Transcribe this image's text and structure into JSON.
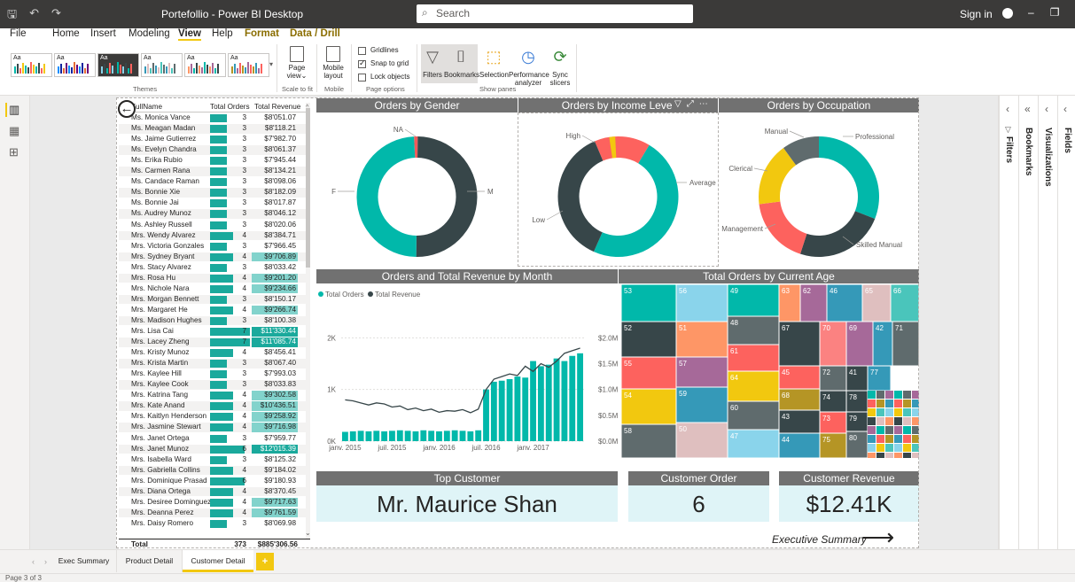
{
  "window": {
    "title": "Portefollio - Power BI Desktop",
    "search_placeholder": "Search",
    "signin": "Sign in",
    "min": "–",
    "max": "❐",
    "close": "✕",
    "save_icon": "🖫",
    "undo": "↶",
    "redo": "↷"
  },
  "menu": [
    "File",
    "Home",
    "Insert",
    "Modeling",
    "View",
    "Help",
    "Format",
    "Data / Drill"
  ],
  "ribbon": {
    "themes_label": "Themes",
    "scale_label": "Scale to fit",
    "page_view": "Page view",
    "page_view_dd": "⌄",
    "mobile_group": "Mobile",
    "mobile_layout": "Mobile layout",
    "page_options_label": "Page options",
    "gridlines": "Gridlines",
    "snap": "Snap to grid",
    "lock": "Lock objects",
    "show_panes_label": "Show panes",
    "panes": [
      "Filters",
      "Bookmarks",
      "Selection",
      "Performance analyzer",
      "Sync slicers"
    ],
    "theme_colors": [
      "#118dff",
      "#12239e",
      "#e66c37",
      "#6b007b",
      "#e044a7",
      "#744ec2",
      "#d9b300",
      "#d64550"
    ]
  },
  "panes": {
    "filters": "Filters",
    "visualizations": "Visualizations",
    "fields": "Fields",
    "bookmarks": "Bookmarks"
  },
  "table": {
    "headers": [
      "FullName",
      "Total Orders",
      "Total Revenue"
    ],
    "rows": [
      [
        "Ms. Monica Vance",
        "3",
        "$8'051.07"
      ],
      [
        "Ms. Meagan Madan",
        "3",
        "$8'118.21"
      ],
      [
        "Ms. Jaime Gutierrez",
        "3",
        "$7'982.70"
      ],
      [
        "Ms. Evelyn Chandra",
        "3",
        "$8'061.37"
      ],
      [
        "Ms. Erika Rubio",
        "3",
        "$7'945.44"
      ],
      [
        "Ms. Carmen Rana",
        "3",
        "$8'134.21"
      ],
      [
        "Ms. Candace Raman",
        "3",
        "$8'098.06"
      ],
      [
        "Ms. Bonnie Xie",
        "3",
        "$8'182.09"
      ],
      [
        "Ms. Bonnie Jai",
        "3",
        "$8'017.87"
      ],
      [
        "Ms. Audrey Munoz",
        "3",
        "$8'046.12"
      ],
      [
        "Ms. Ashley Russell",
        "3",
        "$8'020.06"
      ],
      [
        "Mrs. Wendy Alvarez",
        "4",
        "$8'384.71"
      ],
      [
        "Mrs. Victoria Gonzales",
        "3",
        "$7'966.45"
      ],
      [
        "Mrs. Sydney Bryant",
        "4",
        "$9'706.89"
      ],
      [
        "Mrs. Stacy Alvarez",
        "3",
        "$8'033.42"
      ],
      [
        "Mrs. Rosa Hu",
        "4",
        "$9'201.20"
      ],
      [
        "Mrs. Nichole Nara",
        "4",
        "$9'234.66"
      ],
      [
        "Mrs. Morgan Bennett",
        "3",
        "$8'150.17"
      ],
      [
        "Mrs. Margaret He",
        "4",
        "$9'266.74"
      ],
      [
        "Mrs. Madison Hughes",
        "3",
        "$8'100.38"
      ],
      [
        "Mrs. Lisa Cai",
        "7",
        "$11'330.44"
      ],
      [
        "Mrs. Lacey Zheng",
        "7",
        "$11'085.74"
      ],
      [
        "Mrs. Kristy Munoz",
        "4",
        "$8'456.41"
      ],
      [
        "Mrs. Krista Martin",
        "3",
        "$8'067.40"
      ],
      [
        "Mrs. Kaylee Hill",
        "3",
        "$7'993.03"
      ],
      [
        "Mrs. Kaylee Cook",
        "3",
        "$8'033.83"
      ],
      [
        "Mrs. Katrina Tang",
        "4",
        "$9'302.58"
      ],
      [
        "Mrs. Kate Anand",
        "4",
        "$10'436.51"
      ],
      [
        "Mrs. Kaitlyn Henderson",
        "4",
        "$9'258.92"
      ],
      [
        "Mrs. Jasmine Stewart",
        "4",
        "$9'716.98"
      ],
      [
        "Mrs. Janet Ortega",
        "3",
        "$7'959.77"
      ],
      [
        "Mrs. Janet Munoz",
        "6",
        "$12'015.39"
      ],
      [
        "Mrs. Isabella Ward",
        "3",
        "$8'125.32"
      ],
      [
        "Mrs. Gabriella Collins",
        "4",
        "$9'184.02"
      ],
      [
        "Mrs. Dominique Prasad",
        "6",
        "$9'180.93"
      ],
      [
        "Mrs. Diana Ortega",
        "4",
        "$8'370.45"
      ],
      [
        "Mrs. Desiree Dominguez",
        "4",
        "$9'717.63"
      ],
      [
        "Mrs. Deanna Perez",
        "4",
        "$9'761.59"
      ],
      [
        "Mrs. Daisy Romero",
        "3",
        "$8'069.98"
      ]
    ],
    "total": [
      "Total",
      "373",
      "$885'306.56"
    ],
    "back_icon": "←"
  },
  "donuts": {
    "gender": {
      "title": "Orders by Gender",
      "labels": [
        "NA",
        "F",
        "M"
      ],
      "values": [
        1,
        50,
        49
      ],
      "colors": [
        "#f15a5a",
        "#374649",
        "#01b8aa"
      ]
    },
    "income": {
      "title": "Orders by Income Level",
      "labels": [
        "High",
        "Average",
        "Low"
      ],
      "values": [
        15,
        48,
        37
      ],
      "colors": [
        "#fd625e",
        "#01b8aa",
        "#374649"
      ],
      "accent": "#f2c80f"
    },
    "occupation": {
      "title": "Orders by Occupation",
      "labels": [
        "Professional",
        "Skilled Manual",
        "Management",
        "Clerical",
        "Manual"
      ],
      "values": [
        31,
        24,
        18,
        17,
        10
      ],
      "colors": [
        "#01b8aa",
        "#374649",
        "#fd625e",
        "#f2c80f",
        "#5f6b6d"
      ]
    }
  },
  "chart_data": {
    "type": "bar",
    "title": "Orders and Total Revenue by Month",
    "legend": [
      "Total Orders",
      "Total Revenue"
    ],
    "x_ticks": [
      "janv. 2015",
      "juil. 2015",
      "janv. 2016",
      "juil. 2016",
      "janv. 2017"
    ],
    "y_left_ticks": [
      "0K",
      "1K",
      "2K"
    ],
    "y_right_ticks": [
      "$0.0M",
      "$0.5M",
      "$1.0M",
      "$1.5M",
      "$2.0M"
    ],
    "orders": [
      180,
      190,
      200,
      190,
      200,
      190,
      200,
      210,
      200,
      190,
      210,
      200,
      190,
      200,
      210,
      200,
      190,
      210,
      1000,
      1150,
      1170,
      1200,
      1250,
      1230,
      1550,
      1450,
      1480,
      1600,
      1550,
      1650,
      1700
    ],
    "revenue": [
      0.8,
      0.78,
      0.74,
      0.7,
      0.74,
      0.72,
      0.66,
      0.68,
      0.61,
      0.64,
      0.59,
      0.62,
      0.56,
      0.59,
      0.58,
      0.61,
      0.55,
      0.62,
      1.0,
      1.2,
      1.25,
      1.3,
      1.27,
      1.45,
      1.35,
      1.5,
      1.43,
      1.55,
      1.7,
      1.75,
      1.8
    ],
    "colors": {
      "orders": "#01b8aa",
      "revenue": "#374649"
    }
  },
  "treemap": {
    "title": "Total Orders by Current Age",
    "cells": [
      {
        "label": "53",
        "color": "#01b8aa"
      },
      {
        "label": "56",
        "color": "#8ad4eb"
      },
      {
        "label": "49",
        "color": "#01b8aa"
      },
      {
        "label": "63",
        "color": "#fe9666"
      },
      {
        "label": "62",
        "color": "#a66999"
      },
      {
        "label": "46",
        "color": "#3599b8"
      },
      {
        "label": "65",
        "color": "#dfbfbf"
      },
      {
        "label": "66",
        "color": "#4ac5bb"
      },
      {
        "label": "52",
        "color": "#374649"
      },
      {
        "label": "51",
        "color": "#fe9666"
      },
      {
        "label": "48",
        "color": "#5f6b6d"
      },
      {
        "label": "67",
        "color": "#374649"
      },
      {
        "label": "70",
        "color": "#fb8281"
      },
      {
        "label": "69",
        "color": "#a66999"
      },
      {
        "label": "42",
        "color": "#3599b8"
      },
      {
        "label": "71",
        "color": "#5f6b6d"
      },
      {
        "label": "61",
        "color": "#fd625e"
      },
      {
        "label": "55",
        "color": "#fd625e"
      },
      {
        "label": "57",
        "color": "#a66999"
      },
      {
        "label": "45",
        "color": "#fd625e"
      },
      {
        "label": "72",
        "color": "#5f6b6d"
      },
      {
        "label": "41",
        "color": "#374649"
      },
      {
        "label": "77",
        "color": "#3599b8"
      },
      {
        "label": "64",
        "color": "#f2c80f"
      },
      {
        "label": "68",
        "color": "#b59525"
      },
      {
        "label": "54",
        "color": "#f2c80f"
      },
      {
        "label": "59",
        "color": "#3599b8"
      },
      {
        "label": "60",
        "color": "#5f6b6d"
      },
      {
        "label": "74",
        "color": "#374649"
      },
      {
        "label": "78",
        "color": "#374649"
      },
      {
        "label": "43",
        "color": "#374649"
      },
      {
        "label": "73",
        "color": "#fd625e"
      },
      {
        "label": "79",
        "color": "#374649"
      },
      {
        "label": "58",
        "color": "#5f6b6d"
      },
      {
        "label": "50",
        "color": "#dfbfbf"
      },
      {
        "label": "47",
        "color": "#8ad4eb"
      },
      {
        "label": "44",
        "color": "#3599b8"
      },
      {
        "label": "75",
        "color": "#b59525"
      },
      {
        "label": "80",
        "color": "#5f6b6d"
      }
    ]
  },
  "kpis": {
    "top_customer": {
      "title": "Top Customer",
      "value": "Mr. Maurice Shan"
    },
    "customer_order": {
      "title": "Customer Order",
      "value": "6"
    },
    "customer_revenue": {
      "title": "Customer Revenue",
      "value": "$12.41K"
    },
    "exec_link": "Executive Summary",
    "exec_arrow": "⟶"
  },
  "header_icons": {
    "filter": "▽",
    "focus": "⤢",
    "more": "⋯"
  },
  "tabs": [
    "Exec Summary",
    "Product Detail",
    "Customer Detail"
  ],
  "tab_add": "+",
  "tab_nav": [
    "‹",
    "›"
  ],
  "status": "Page 3 of 3"
}
